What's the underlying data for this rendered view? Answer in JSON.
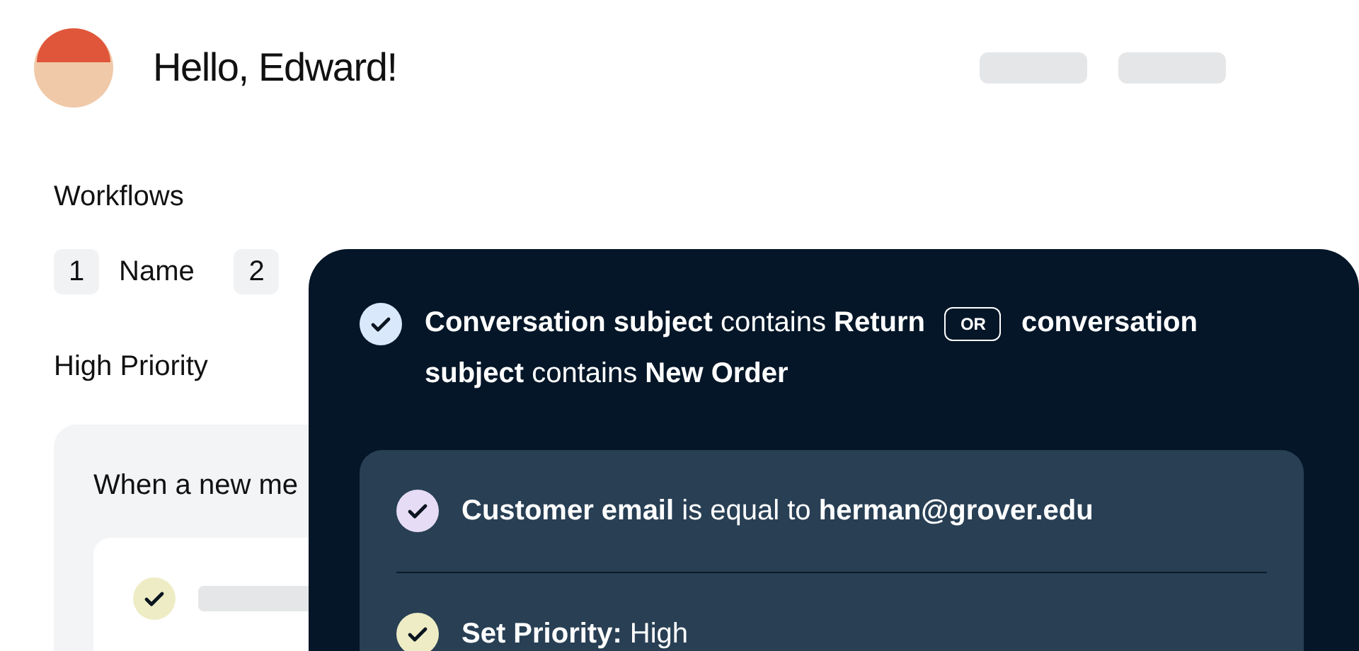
{
  "greeting": "Hello, Edward!",
  "section_title": "Workflows",
  "steps": [
    {
      "number": "1",
      "label": "Name"
    },
    {
      "number": "2"
    }
  ],
  "workflow_name": "High Priority",
  "trigger_card": {
    "text": "When a new me",
    "actions": [
      {
        "color": "#eeecc5"
      }
    ]
  },
  "rule_panel": {
    "condition": {
      "color": "#d9e9fb",
      "text_before": "**Conversation subject** contains **Return**",
      "operator": "OR",
      "text_after": "**conversation subject** contains **New Order**"
    },
    "steps": [
      {
        "color": "#e6dcf5",
        "text": "**Customer email** is equal to **herman@grover.edu**"
      },
      {
        "color": "#eeecc5",
        "text": "**Set Priority:** High"
      }
    ]
  }
}
